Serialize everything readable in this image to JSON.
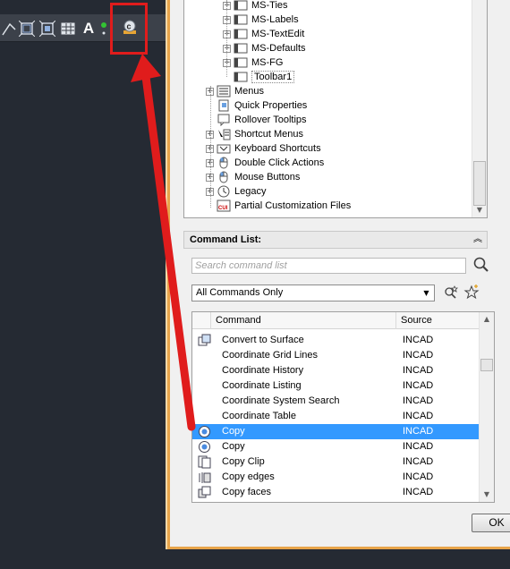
{
  "toolbar": {
    "icons": [
      "polyline-icon",
      "ucs-icon",
      "table-icon",
      "text-icon",
      "copy-icon"
    ],
    "text_tool_label": "A",
    "highlighted_tool": "copy-icon"
  },
  "colors": {
    "highlight": "#e01c1c",
    "arrow": "#e01c1c",
    "dialog_border": "#e8a44a",
    "selection": "#3399ff"
  },
  "tree": {
    "items": [
      {
        "label": "MS-Ties",
        "icon": "toolbar-icon",
        "expander": "+"
      },
      {
        "label": "MS-Labels",
        "icon": "toolbar-icon",
        "expander": "+"
      },
      {
        "label": "MS-TextEdit",
        "icon": "toolbar-icon",
        "expander": "+"
      },
      {
        "label": "MS-Defaults",
        "icon": "toolbar-icon",
        "expander": "+"
      },
      {
        "label": "MS-FG",
        "icon": "toolbar-icon",
        "expander": "+"
      },
      {
        "label": "Toolbar1",
        "icon": "toolbar-icon",
        "expander": ""
      },
      {
        "label": "Menus",
        "icon": "menu-icon",
        "expander": "+"
      },
      {
        "label": "Quick Properties",
        "icon": "properties-icon",
        "expander": ""
      },
      {
        "label": "Rollover Tooltips",
        "icon": "tooltip-icon",
        "expander": ""
      },
      {
        "label": "Shortcut Menus",
        "icon": "shortcut-menu-icon",
        "expander": "+"
      },
      {
        "label": "Keyboard Shortcuts",
        "icon": "keyboard-icon",
        "expander": "+"
      },
      {
        "label": "Double Click Actions",
        "icon": "mouse-icon",
        "expander": "+"
      },
      {
        "label": "Mouse Buttons",
        "icon": "mouse-icon",
        "expander": "+"
      },
      {
        "label": "Legacy",
        "icon": "legacy-icon",
        "expander": "+"
      },
      {
        "label": "Partial Customization Files",
        "icon": "cui-file-icon",
        "expander": ""
      }
    ]
  },
  "command_list": {
    "title": "Command List:",
    "search_placeholder": "Search command list",
    "filter_value": "All Commands Only",
    "columns": [
      "Command",
      "Source"
    ],
    "rows": [
      {
        "command": "Convert to Surface",
        "source": "INCAD",
        "icon": "surface-icon"
      },
      {
        "command": "Coordinate Grid Lines",
        "source": "INCAD",
        "icon": ""
      },
      {
        "command": "Coordinate History",
        "source": "INCAD",
        "icon": ""
      },
      {
        "command": "Coordinate Listing",
        "source": "INCAD",
        "icon": ""
      },
      {
        "command": "Coordinate System Search",
        "source": "INCAD",
        "icon": ""
      },
      {
        "command": "Coordinate Table",
        "source": "INCAD",
        "icon": ""
      },
      {
        "command": "Copy",
        "source": "INCAD",
        "icon": "copy-icon",
        "selected": true
      },
      {
        "command": "Copy",
        "source": "INCAD",
        "icon": "copy-icon"
      },
      {
        "command": "Copy Clip",
        "source": "INCAD",
        "icon": "copy-clip-icon"
      },
      {
        "command": "Copy edges",
        "source": "INCAD",
        "icon": "copy-edges-icon"
      },
      {
        "command": "Copy faces",
        "source": "INCAD",
        "icon": "copy-faces-icon"
      }
    ]
  },
  "buttons": {
    "ok": "OK",
    "cui_badge": "CUI"
  }
}
